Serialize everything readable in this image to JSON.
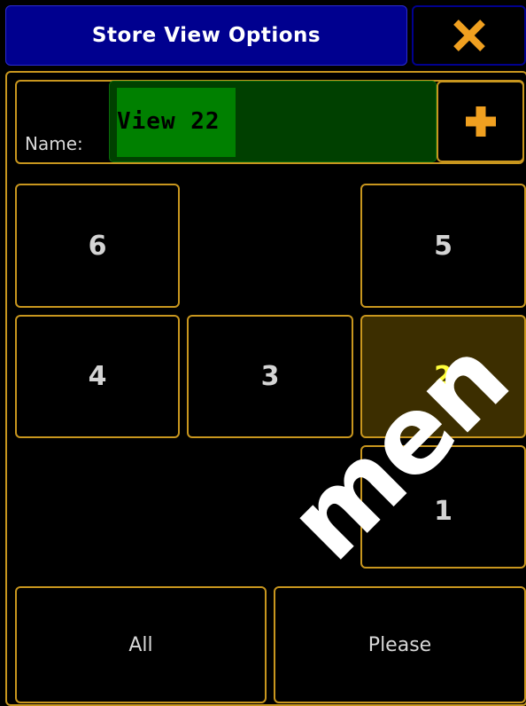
{
  "dialog": {
    "title": "Store View Options",
    "close_icon": "close-icon",
    "name_label": "Name:",
    "name_value": "View 22",
    "add_icon": "plus-icon"
  },
  "colors": {
    "title_bg": "#00008f",
    "border": "#c8961e",
    "input_bg": "#004000",
    "input_selection": "#008000",
    "active_bg": "#3c2e00",
    "active_text": "#ffff3a",
    "icon": "#f0a020"
  },
  "grid": {
    "cells": [
      {
        "label": "6",
        "active": false
      },
      {
        "label": "5",
        "active": false
      },
      {
        "label": "4",
        "active": false
      },
      {
        "label": "3",
        "active": false
      },
      {
        "label": "2",
        "active": true
      },
      {
        "label": "1",
        "active": false
      }
    ]
  },
  "buttons": {
    "all": "All",
    "please": "Please"
  },
  "watermark": "men"
}
